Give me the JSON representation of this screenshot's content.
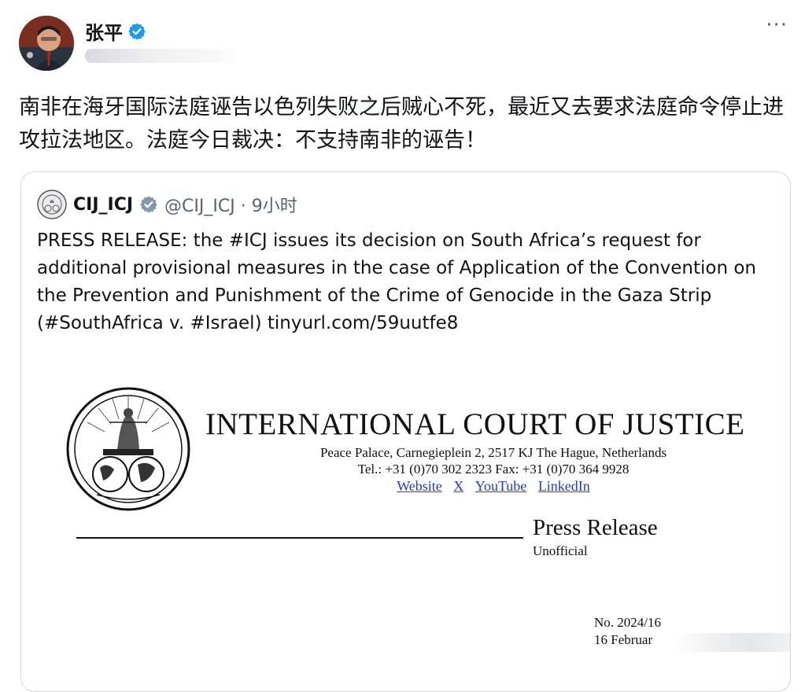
{
  "author": {
    "name": "张平",
    "verified_icon": "verified-badge-icon",
    "accent": "#1d9bf0"
  },
  "menu": {
    "more_label": "···"
  },
  "tweet": {
    "text": "南非在海牙国际法庭诬告以色列失败之后贼心不死，最近又去要求法庭命令停止进攻拉法地区。法庭今日裁决：不支持南非的诬告！"
  },
  "quote": {
    "name": "CIJ_ICJ",
    "handle_time": "@CIJ_ICJ · 9小时",
    "text": "PRESS RELEASE: the #ICJ issues its decision on South Africa’s request for additional provisional measures in the case of Application of the Convention on the Prevention and Punishment of the Crime of Genocide in the Gaza Strip (#SouthAfrica v. #Israel) tinyurl.com/59uutfe8",
    "document": {
      "court": "INTERNATIONAL COURT OF JUSTICE",
      "address": "Peace Palace, Carnegieplein 2, 2517 KJ  The Hague, Netherlands",
      "phone_fax": "Tel.: +31 (0)70 302 2323   Fax: +31 (0)70 364 9928",
      "links": [
        "Website",
        "X",
        "YouTube",
        "LinkedIn"
      ],
      "press_release": "Press Release",
      "unofficial": "Unofficial",
      "number": "No. 2024/16",
      "date_partial": "16 Februar"
    }
  }
}
